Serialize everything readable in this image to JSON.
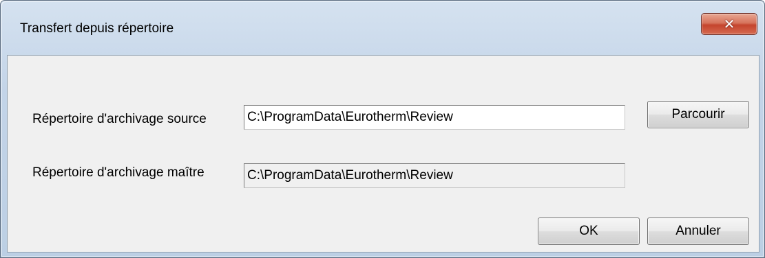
{
  "window": {
    "title": "Transfert depuis répertoire",
    "close_icon": "close-icon"
  },
  "form": {
    "source_label": "Répertoire d'archivage source",
    "source_value": "C:\\ProgramData\\Eurotherm\\Review",
    "master_label": "Répertoire d'archivage maître",
    "master_value": "C:\\ProgramData\\Eurotherm\\Review"
  },
  "buttons": {
    "browse": "Parcourir",
    "ok": "OK",
    "cancel": "Annuler"
  }
}
